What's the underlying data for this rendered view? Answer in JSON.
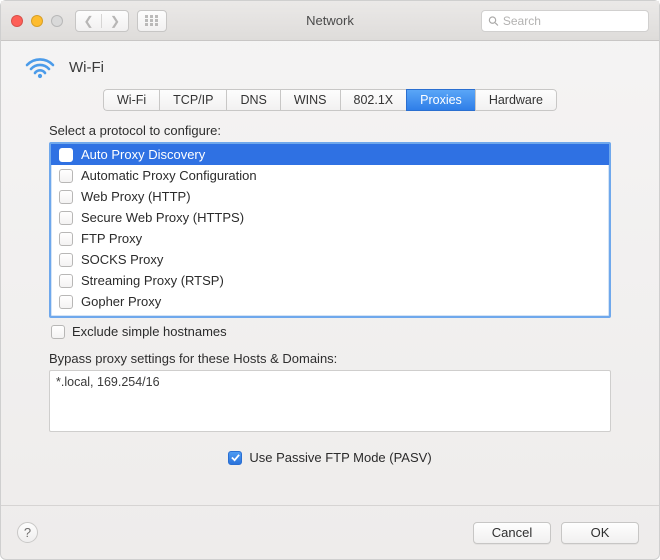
{
  "window": {
    "title": "Network"
  },
  "search": {
    "placeholder": "Search"
  },
  "header": {
    "label": "Wi-Fi"
  },
  "tabs": [
    {
      "label": "Wi-Fi",
      "selected": false
    },
    {
      "label": "TCP/IP",
      "selected": false
    },
    {
      "label": "DNS",
      "selected": false
    },
    {
      "label": "WINS",
      "selected": false
    },
    {
      "label": "802.1X",
      "selected": false
    },
    {
      "label": "Proxies",
      "selected": true
    },
    {
      "label": "Hardware",
      "selected": false
    }
  ],
  "protocol_label": "Select a protocol to configure:",
  "protocols": [
    {
      "label": "Auto Proxy Discovery",
      "checked": true,
      "selected": true
    },
    {
      "label": "Automatic Proxy Configuration",
      "checked": false,
      "selected": false
    },
    {
      "label": "Web Proxy (HTTP)",
      "checked": false,
      "selected": false
    },
    {
      "label": "Secure Web Proxy (HTTPS)",
      "checked": false,
      "selected": false
    },
    {
      "label": "FTP Proxy",
      "checked": false,
      "selected": false
    },
    {
      "label": "SOCKS Proxy",
      "checked": false,
      "selected": false
    },
    {
      "label": "Streaming Proxy (RTSP)",
      "checked": false,
      "selected": false
    },
    {
      "label": "Gopher Proxy",
      "checked": false,
      "selected": false
    }
  ],
  "exclude_simple": {
    "label": "Exclude simple hostnames",
    "checked": false
  },
  "bypass_label": "Bypass proxy settings for these Hosts & Domains:",
  "bypass_value": "*.local, 169.254/16",
  "passive_ftp": {
    "label": "Use Passive FTP Mode (PASV)",
    "checked": true
  },
  "buttons": {
    "cancel": "Cancel",
    "ok": "OK"
  },
  "colors": {
    "accent": "#2f71e3",
    "accent_border": "#6fa8ec"
  }
}
